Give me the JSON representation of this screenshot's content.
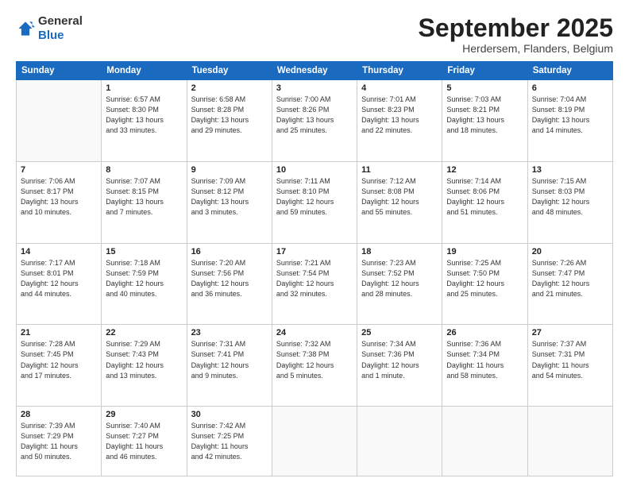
{
  "header": {
    "logo_general": "General",
    "logo_blue": "Blue",
    "month_title": "September 2025",
    "subtitle": "Herdersem, Flanders, Belgium"
  },
  "days_of_week": [
    "Sunday",
    "Monday",
    "Tuesday",
    "Wednesday",
    "Thursday",
    "Friday",
    "Saturday"
  ],
  "weeks": [
    [
      {
        "num": "",
        "info": ""
      },
      {
        "num": "1",
        "info": "Sunrise: 6:57 AM\nSunset: 8:30 PM\nDaylight: 13 hours\nand 33 minutes."
      },
      {
        "num": "2",
        "info": "Sunrise: 6:58 AM\nSunset: 8:28 PM\nDaylight: 13 hours\nand 29 minutes."
      },
      {
        "num": "3",
        "info": "Sunrise: 7:00 AM\nSunset: 8:26 PM\nDaylight: 13 hours\nand 25 minutes."
      },
      {
        "num": "4",
        "info": "Sunrise: 7:01 AM\nSunset: 8:23 PM\nDaylight: 13 hours\nand 22 minutes."
      },
      {
        "num": "5",
        "info": "Sunrise: 7:03 AM\nSunset: 8:21 PM\nDaylight: 13 hours\nand 18 minutes."
      },
      {
        "num": "6",
        "info": "Sunrise: 7:04 AM\nSunset: 8:19 PM\nDaylight: 13 hours\nand 14 minutes."
      }
    ],
    [
      {
        "num": "7",
        "info": "Sunrise: 7:06 AM\nSunset: 8:17 PM\nDaylight: 13 hours\nand 10 minutes."
      },
      {
        "num": "8",
        "info": "Sunrise: 7:07 AM\nSunset: 8:15 PM\nDaylight: 13 hours\nand 7 minutes."
      },
      {
        "num": "9",
        "info": "Sunrise: 7:09 AM\nSunset: 8:12 PM\nDaylight: 13 hours\nand 3 minutes."
      },
      {
        "num": "10",
        "info": "Sunrise: 7:11 AM\nSunset: 8:10 PM\nDaylight: 12 hours\nand 59 minutes."
      },
      {
        "num": "11",
        "info": "Sunrise: 7:12 AM\nSunset: 8:08 PM\nDaylight: 12 hours\nand 55 minutes."
      },
      {
        "num": "12",
        "info": "Sunrise: 7:14 AM\nSunset: 8:06 PM\nDaylight: 12 hours\nand 51 minutes."
      },
      {
        "num": "13",
        "info": "Sunrise: 7:15 AM\nSunset: 8:03 PM\nDaylight: 12 hours\nand 48 minutes."
      }
    ],
    [
      {
        "num": "14",
        "info": "Sunrise: 7:17 AM\nSunset: 8:01 PM\nDaylight: 12 hours\nand 44 minutes."
      },
      {
        "num": "15",
        "info": "Sunrise: 7:18 AM\nSunset: 7:59 PM\nDaylight: 12 hours\nand 40 minutes."
      },
      {
        "num": "16",
        "info": "Sunrise: 7:20 AM\nSunset: 7:56 PM\nDaylight: 12 hours\nand 36 minutes."
      },
      {
        "num": "17",
        "info": "Sunrise: 7:21 AM\nSunset: 7:54 PM\nDaylight: 12 hours\nand 32 minutes."
      },
      {
        "num": "18",
        "info": "Sunrise: 7:23 AM\nSunset: 7:52 PM\nDaylight: 12 hours\nand 28 minutes."
      },
      {
        "num": "19",
        "info": "Sunrise: 7:25 AM\nSunset: 7:50 PM\nDaylight: 12 hours\nand 25 minutes."
      },
      {
        "num": "20",
        "info": "Sunrise: 7:26 AM\nSunset: 7:47 PM\nDaylight: 12 hours\nand 21 minutes."
      }
    ],
    [
      {
        "num": "21",
        "info": "Sunrise: 7:28 AM\nSunset: 7:45 PM\nDaylight: 12 hours\nand 17 minutes."
      },
      {
        "num": "22",
        "info": "Sunrise: 7:29 AM\nSunset: 7:43 PM\nDaylight: 12 hours\nand 13 minutes."
      },
      {
        "num": "23",
        "info": "Sunrise: 7:31 AM\nSunset: 7:41 PM\nDaylight: 12 hours\nand 9 minutes."
      },
      {
        "num": "24",
        "info": "Sunrise: 7:32 AM\nSunset: 7:38 PM\nDaylight: 12 hours\nand 5 minutes."
      },
      {
        "num": "25",
        "info": "Sunrise: 7:34 AM\nSunset: 7:36 PM\nDaylight: 12 hours\nand 1 minute."
      },
      {
        "num": "26",
        "info": "Sunrise: 7:36 AM\nSunset: 7:34 PM\nDaylight: 11 hours\nand 58 minutes."
      },
      {
        "num": "27",
        "info": "Sunrise: 7:37 AM\nSunset: 7:31 PM\nDaylight: 11 hours\nand 54 minutes."
      }
    ],
    [
      {
        "num": "28",
        "info": "Sunrise: 7:39 AM\nSunset: 7:29 PM\nDaylight: 11 hours\nand 50 minutes."
      },
      {
        "num": "29",
        "info": "Sunrise: 7:40 AM\nSunset: 7:27 PM\nDaylight: 11 hours\nand 46 minutes."
      },
      {
        "num": "30",
        "info": "Sunrise: 7:42 AM\nSunset: 7:25 PM\nDaylight: 11 hours\nand 42 minutes."
      },
      {
        "num": "",
        "info": ""
      },
      {
        "num": "",
        "info": ""
      },
      {
        "num": "",
        "info": ""
      },
      {
        "num": "",
        "info": ""
      }
    ]
  ]
}
